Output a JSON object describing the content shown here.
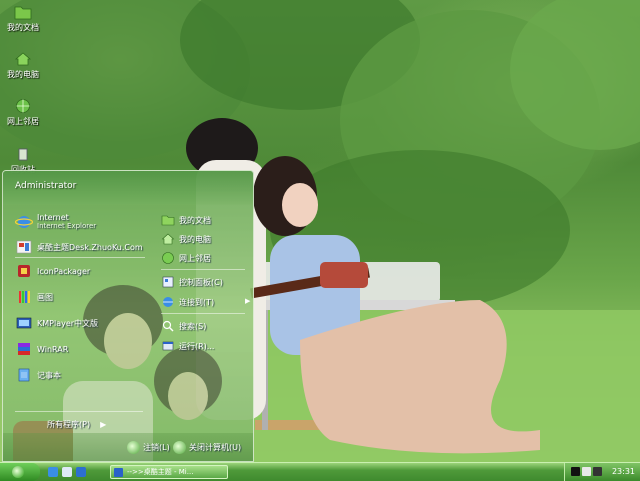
{
  "desktop": {
    "icons": [
      {
        "label": "我的文档",
        "icon": "folder-icon"
      },
      {
        "label": "我的电脑",
        "icon": "computer-icon"
      },
      {
        "label": "网上邻居",
        "icon": "network-icon"
      },
      {
        "label": "回收站",
        "icon": "recycle-bin-icon"
      }
    ]
  },
  "start_menu": {
    "user": "Administrator",
    "pinned": [
      {
        "title": "Internet",
        "subtitle": "Internet Explorer",
        "icon": "internet-explorer-icon"
      },
      {
        "title": "桌酷主题Desk.ZhuoKu.Com",
        "subtitle": "",
        "icon": "zhuoku-icon"
      }
    ],
    "recent": [
      {
        "title": "IconPackager",
        "icon": "iconpackager-icon"
      },
      {
        "title": "画图",
        "icon": "paint-icon"
      },
      {
        "title": "KMPlayer中文版",
        "icon": "kmplayer-icon"
      },
      {
        "title": "WinRAR",
        "icon": "winrar-icon"
      },
      {
        "title": "记事本",
        "icon": "notepad-icon"
      }
    ],
    "all_programs": "所有程序(P)",
    "right": [
      {
        "label": "我的文档",
        "icon": "folder-icon"
      },
      {
        "label": "我的电脑",
        "icon": "computer-icon"
      },
      {
        "label": "网上邻居",
        "icon": "network-icon"
      },
      {
        "label": "控制面板(C)",
        "icon": "control-panel-icon"
      },
      {
        "label": "连接到(T)",
        "icon": "connect-icon"
      },
      {
        "label": "搜索(S)",
        "icon": "search-icon"
      },
      {
        "label": "运行(R)...",
        "icon": "run-icon"
      }
    ],
    "logoff": "注销(L)",
    "shutdown": "关闭计算机(U)"
  },
  "taskbar": {
    "task_label": "-->>桌酷主题 - Mi...",
    "clock": "23:31"
  },
  "colors": {
    "taskbar_green": "#3f8a2e",
    "menu_green": "#6eaa5a"
  }
}
